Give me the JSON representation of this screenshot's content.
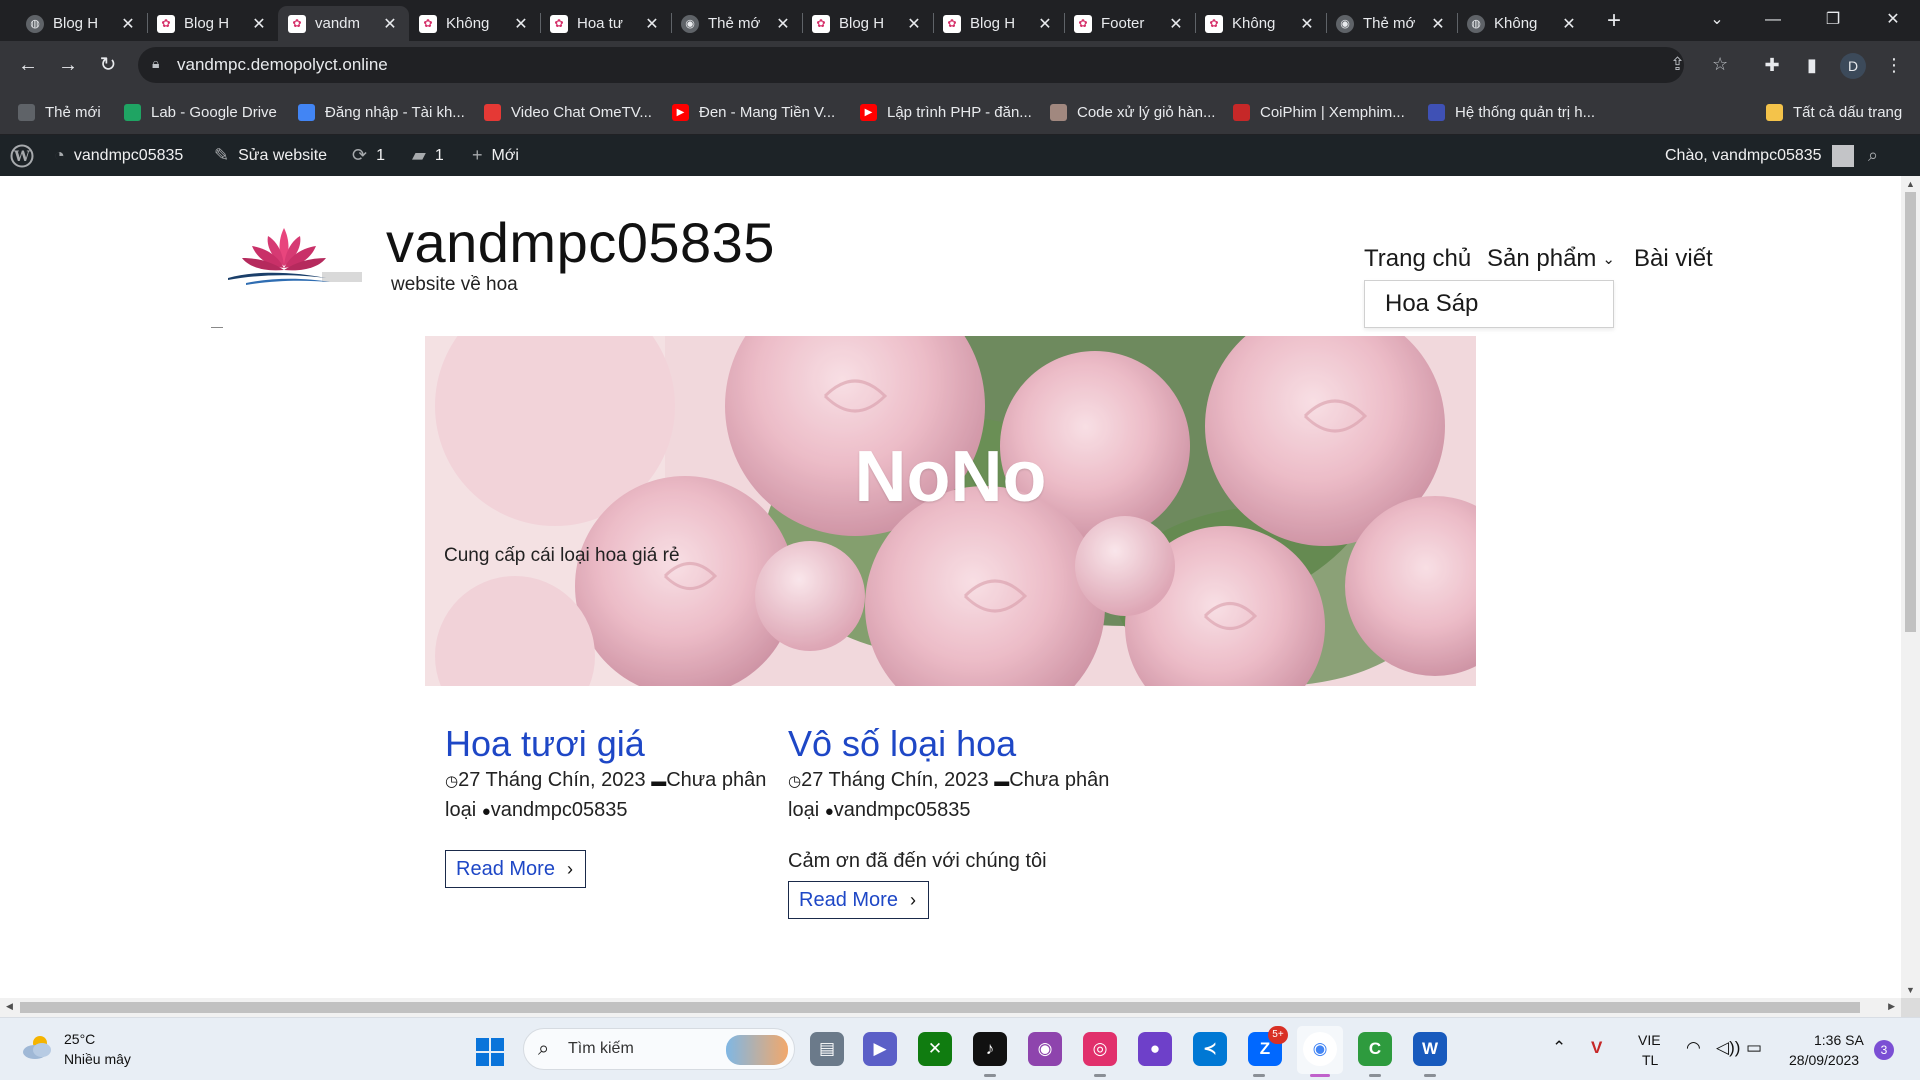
{
  "browser": {
    "tabs": [
      {
        "title": "Blog H",
        "icon": "globe"
      },
      {
        "title": "Blog H",
        "icon": "site"
      },
      {
        "title": "vandm",
        "icon": "site",
        "active": true
      },
      {
        "title": "Không",
        "icon": "site"
      },
      {
        "title": "Hoa tư",
        "icon": "site"
      },
      {
        "title": "Thẻ mớ",
        "icon": "chrome"
      },
      {
        "title": "Blog H",
        "icon": "site"
      },
      {
        "title": "Blog H",
        "icon": "site"
      },
      {
        "title": "Footer",
        "icon": "site"
      },
      {
        "title": "Không",
        "icon": "site"
      },
      {
        "title": "Thẻ mớ",
        "icon": "chrome"
      },
      {
        "title": "Không",
        "icon": "globe"
      }
    ],
    "tab_close_glyph": "✕",
    "new_tab_glyph": "+",
    "url": "vandmpc.demopolyct.online",
    "profile_initial": "D",
    "bookmarks": [
      {
        "label": "Thẻ mới",
        "icon": "globe",
        "color": "#5f6368"
      },
      {
        "label": "Lab - Google Drive",
        "icon": "drive",
        "color": "#1fa463"
      },
      {
        "label": "Đăng nhập - Tài kh...",
        "icon": "google",
        "color": "#4285f4"
      },
      {
        "label": "Video Chat OmeTV...",
        "icon": "ometv",
        "color": "#e53935"
      },
      {
        "label": "Đen - Mang Tiền V...",
        "icon": "youtube",
        "color": "#ff0000"
      },
      {
        "label": "Lập trình PHP - đăn...",
        "icon": "youtube",
        "color": "#ff0000"
      },
      {
        "label": "Code xử lý giỏ hàn...",
        "icon": "avatar",
        "color": "#a1887f"
      },
      {
        "label": "CoiPhim | Xemphim...",
        "icon": "coiphim",
        "color": "#c62828"
      },
      {
        "label": "Hệ thống quản trị h...",
        "icon": "admin",
        "color": "#3f51b5"
      }
    ],
    "all_bookmarks": "Tất cả dấu trang"
  },
  "wp_admin": {
    "site_name": "vandmpc05835",
    "edit_site": "Sửa website",
    "updates_count": "1",
    "comments_count": "1",
    "new_label": "Mới",
    "greeting": "Chào, vandmpc05835"
  },
  "site": {
    "title": "vandmpc05835",
    "tagline": "website về hoa",
    "menu": {
      "home": "Trang chủ",
      "products": "Sản phẩm",
      "posts": "Bài viết",
      "submenu_item": "Hoa Sáp"
    },
    "hero": {
      "title": "NoNo",
      "subtitle": "Cung cấp cái loại hoa giá rẻ"
    },
    "posts": [
      {
        "title": "Hoa tươi giá",
        "date": "27 Tháng Chín, 2023",
        "category": "Chưa phân loại",
        "author": "vandmpc05835",
        "excerpt": "",
        "read_more": "Read More"
      },
      {
        "title": "Vô số loại hoa",
        "date": "27 Tháng Chín, 2023",
        "category": "Chưa phân loại",
        "author": "vandmpc05835",
        "excerpt": "Cảm ơn đã đến với chúng tôi",
        "read_more": "Read More"
      }
    ]
  },
  "taskbar": {
    "weather_temp": "25°C",
    "weather_desc": "Nhiều mây",
    "search_placeholder": "Tìm kiếm",
    "apps": [
      "file-explorer",
      "meet",
      "xbox",
      "tiktok",
      "podcasts",
      "instagram",
      "github",
      "vscode",
      "zalo",
      "chrome",
      "ccleaner",
      "word"
    ],
    "zalo_badge": "5+",
    "lang_line1": "VIE",
    "lang_line2": "TL",
    "time": "1:36 SA",
    "date": "28/09/2023",
    "notifications": "3"
  },
  "colors": {
    "accent_link": "#1e47c6",
    "wp_bar": "#1d2327",
    "chrome_dark": "#202124"
  }
}
